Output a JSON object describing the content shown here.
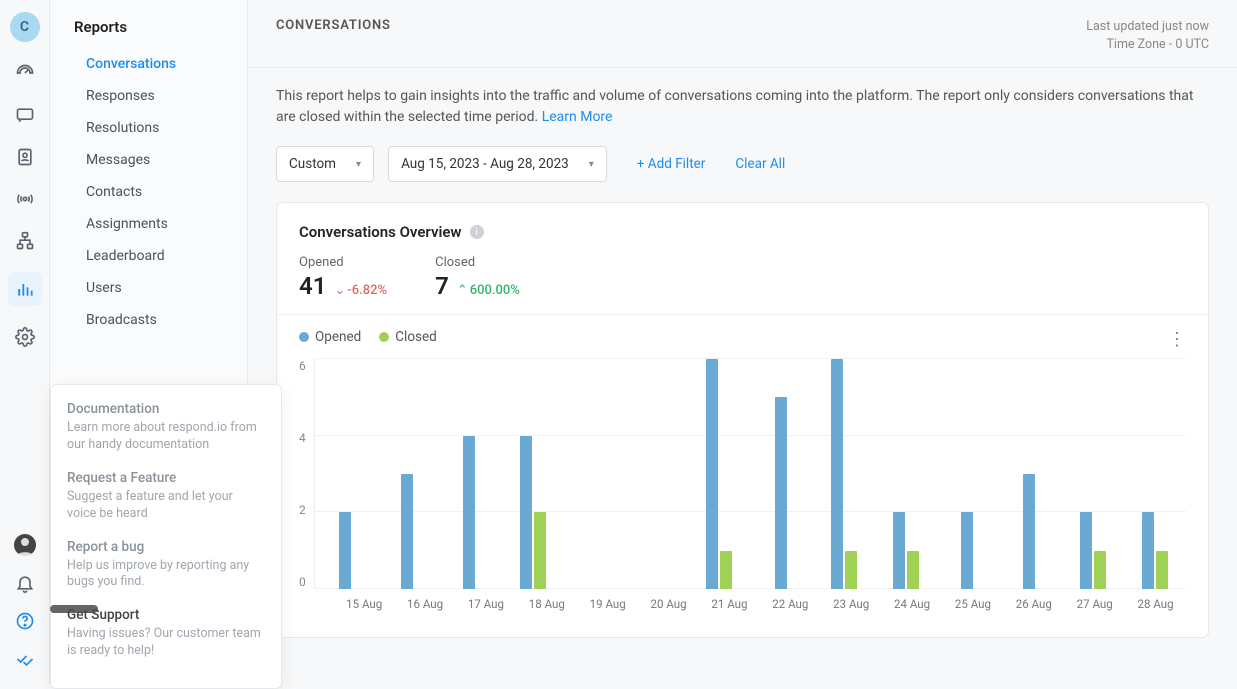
{
  "colors": {
    "opened": "#6aa9d2",
    "closed": "#9ed154",
    "accent": "#1f8ded"
  },
  "avatar_letter": "C",
  "sidebar": {
    "title": "Reports",
    "items": [
      {
        "label": "Conversations",
        "active": true
      },
      {
        "label": "Responses"
      },
      {
        "label": "Resolutions"
      },
      {
        "label": "Messages"
      },
      {
        "label": "Contacts"
      },
      {
        "label": "Assignments"
      },
      {
        "label": "Leaderboard"
      },
      {
        "label": "Users"
      },
      {
        "label": "Broadcasts"
      }
    ]
  },
  "help_popup": {
    "items": [
      {
        "title": "Documentation",
        "desc": "Learn more about respond.io from our handy documentation"
      },
      {
        "title": "Request a Feature",
        "desc": "Suggest a feature and let your voice be heard"
      },
      {
        "title": "Report a bug",
        "desc": "Help us improve by reporting any bugs you find."
      },
      {
        "title": "Get Support",
        "desc": "Having issues? Our customer team is ready to help!",
        "highlight": true
      }
    ]
  },
  "tooltip_text": "",
  "main": {
    "title": "CONVERSATIONS",
    "updated": "Last updated just now",
    "timezone": "Time Zone - 0 UTC",
    "description_pre": "This report helps to gain insights into the traffic and volume of conversations coming into the platform. The report only considers conversations that are closed within the selected time period. ",
    "learn_more": "Learn More",
    "range_preset": "Custom",
    "range_value": "Aug 15, 2023 - Aug 28, 2023",
    "add_filter": "+ Add Filter",
    "clear_all": "Clear All"
  },
  "overview": {
    "title": "Conversations Overview",
    "opened_label": "Opened",
    "opened_value": "41",
    "opened_delta": "-6.82%",
    "closed_label": "Closed",
    "closed_value": "7",
    "closed_delta": "600.00%",
    "legend_opened": "Opened",
    "legend_closed": "Closed"
  },
  "chart_data": {
    "type": "bar",
    "title": "Conversations Overview",
    "xlabel": "",
    "ylabel": "",
    "ylim": [
      0,
      6
    ],
    "y_ticks": [
      0,
      2,
      4,
      6
    ],
    "categories": [
      "15 Aug",
      "16 Aug",
      "17 Aug",
      "18 Aug",
      "19 Aug",
      "20 Aug",
      "21 Aug",
      "22 Aug",
      "23 Aug",
      "24 Aug",
      "25 Aug",
      "26 Aug",
      "27 Aug",
      "28 Aug"
    ],
    "series": [
      {
        "name": "Opened",
        "color": "#6aa9d2",
        "values": [
          2,
          3,
          4,
          4,
          0,
          0,
          6,
          5,
          6,
          2,
          2,
          3,
          2,
          2
        ]
      },
      {
        "name": "Closed",
        "color": "#9ed154",
        "values": [
          0,
          0,
          0,
          2,
          0,
          0,
          1,
          0,
          1,
          1,
          0,
          0,
          1,
          1
        ]
      }
    ]
  }
}
